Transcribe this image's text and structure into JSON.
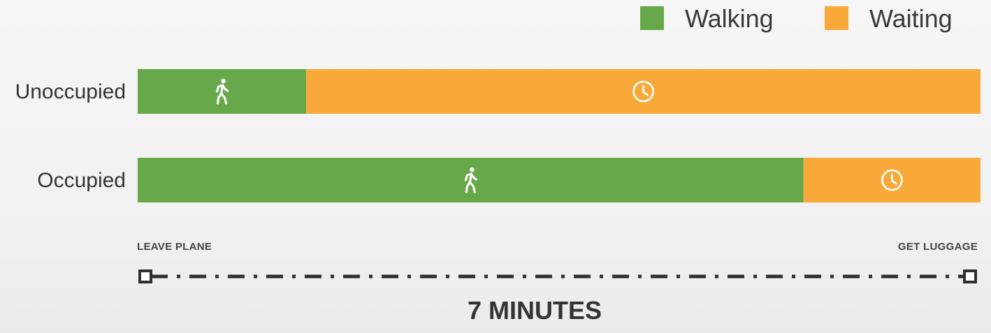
{
  "chart_data": {
    "type": "bar",
    "orientation": "horizontal",
    "stacked": true,
    "legend_position": "top-right",
    "categories": [
      "Unoccupied",
      "Occupied"
    ],
    "series": [
      {
        "name": "Walking",
        "color": "#66a84a",
        "icon": "walking-person-icon",
        "values": [
          0.2,
          0.79
        ]
      },
      {
        "name": "Waiting",
        "color": "#f8a93a",
        "icon": "clock-icon",
        "values": [
          0.8,
          0.21
        ]
      }
    ],
    "value_unit": "fraction of total time",
    "axis": {
      "start_label": "LEAVE PLANE",
      "end_label": "GET LUGGAGE",
      "total_label": "7 MINUTES"
    }
  }
}
